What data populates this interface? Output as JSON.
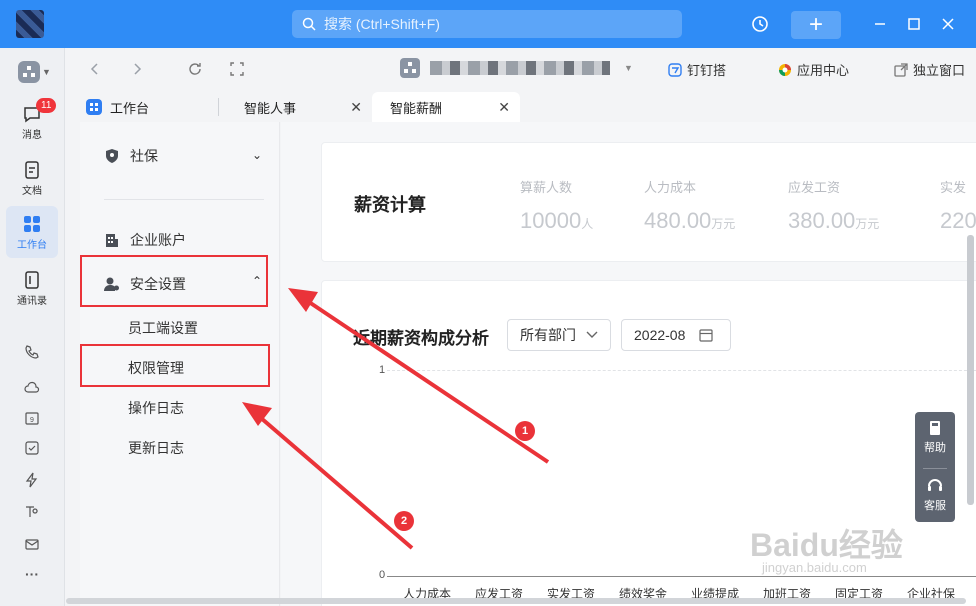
{
  "search": {
    "placeholder": "搜索 (Ctrl+Shift+F)"
  },
  "nav": {
    "messages_label": "消息",
    "messages_badge": "11",
    "docs_label": "文档",
    "workbench_label": "工作台",
    "contacts_label": "通讯录",
    "more_label": "···"
  },
  "toolbar": {
    "dingtalk_label": "钉钉搭",
    "app_center_label": "应用中心",
    "standalone_label": "独立窗口"
  },
  "tabs": [
    {
      "label": "工作台"
    },
    {
      "label": "智能人事",
      "close": "✕"
    },
    {
      "label": "智能薪酬",
      "close": "✕"
    }
  ],
  "sidemenu": {
    "social_security": "社保",
    "enterprise_account": "企业账户",
    "security_settings": "安全设置",
    "employee_settings": "员工端设置",
    "permission_management": "权限管理",
    "operation_log": "操作日志",
    "update_log": "更新日志"
  },
  "payroll": {
    "title": "薪资计算",
    "stats": [
      {
        "label": "算薪人数",
        "value": "10000",
        "unit": "人"
      },
      {
        "label": "人力成本",
        "value": "480.00",
        "unit": "万元"
      },
      {
        "label": "应发工资",
        "value": "380.00",
        "unit": "万元"
      },
      {
        "label": "实发",
        "value": "220",
        "unit": ""
      }
    ]
  },
  "analysis": {
    "title": "近期薪资构成分析",
    "dept_select": "所有部门",
    "date_select": "2022-08"
  },
  "chart_data": {
    "type": "bar",
    "categories": [
      "人力成本",
      "应发工资",
      "实发工资",
      "绩效奖金",
      "业绩提成",
      "加班工资",
      "固定工资",
      "企业社保"
    ],
    "values": [
      0,
      0,
      0,
      0,
      0,
      0,
      0,
      0
    ],
    "ylim": [
      0,
      1
    ],
    "yticks": [
      "1",
      "0"
    ]
  },
  "help": {
    "help_label": "帮助",
    "service_label": "客服"
  },
  "annotations": {
    "n1": "1",
    "n2": "2"
  },
  "watermark": {
    "main": "Baidu经验",
    "sub": "jingyan.baidu.com"
  },
  "colors": {
    "accent": "#2f8cf6",
    "annotation": "#ea3339"
  }
}
